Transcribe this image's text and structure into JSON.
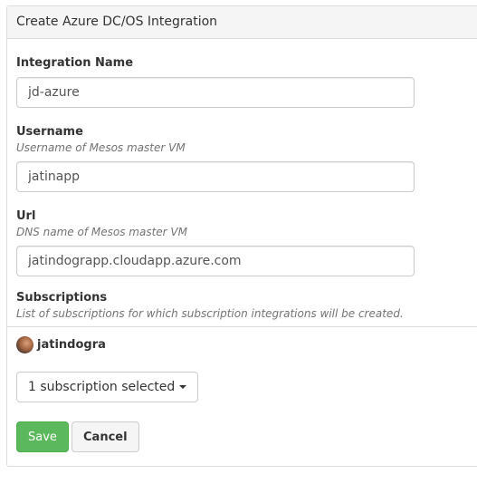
{
  "form": {
    "title": "Create Azure DC/OS Integration",
    "integration_name": {
      "label": "Integration Name",
      "value": "jd-azure"
    },
    "username": {
      "label": "Username",
      "help": "Username of Mesos master VM",
      "value": "jatinapp"
    },
    "url": {
      "label": "Url",
      "help": "DNS name of Mesos master VM",
      "value": "jatindograpp.cloudapp.azure.com"
    },
    "subscriptions": {
      "label": "Subscriptions",
      "help": "List of subscriptions for which subscription integrations will be created.",
      "account_name": "jatindogra",
      "dropdown_label": "1 subscription selected"
    },
    "save_label": "Save",
    "cancel_label": "Cancel"
  }
}
